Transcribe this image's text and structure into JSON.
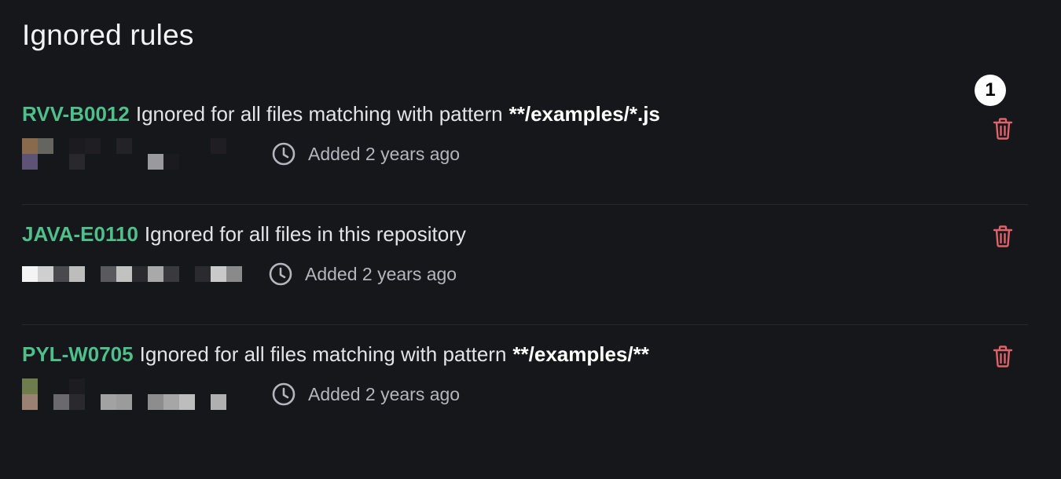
{
  "page": {
    "title": "Ignored rules"
  },
  "annotation": {
    "badge_label": "1"
  },
  "rules": [
    {
      "code": "RVV-B0012",
      "description": "Ignored for all files matching with pattern",
      "pattern": "**/examples/*.js",
      "added": "Added 2 years ago"
    },
    {
      "code": "JAVA-E0110",
      "description": "Ignored for all files in this repository",
      "pattern": "",
      "added": "Added 2 years ago"
    },
    {
      "code": "PYL-W0705",
      "description": "Ignored for all files matching with pattern",
      "pattern": "**/examples/**",
      "added": "Added 2 years ago"
    }
  ],
  "icons": {
    "clock": "clock-icon",
    "delete": "trash-icon"
  },
  "colors": {
    "background": "#16171b",
    "rule_code": "#4fbf8b",
    "delete_icon": "#e0626a",
    "muted_text": "#b3b6bd"
  }
}
